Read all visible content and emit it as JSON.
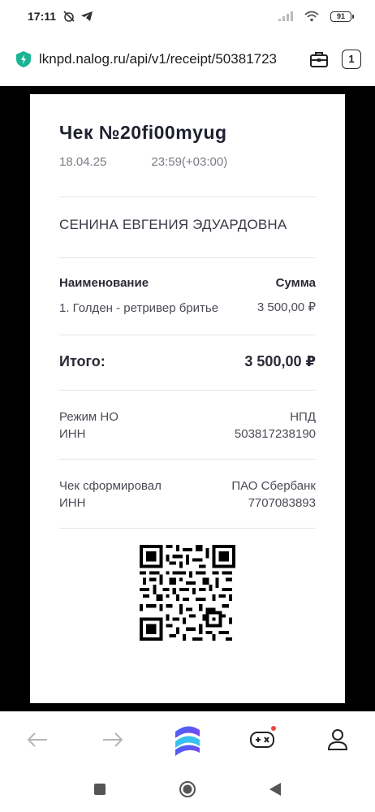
{
  "status_bar": {
    "time": "17:11",
    "battery": "91"
  },
  "browser": {
    "url": "lknpd.nalog.ru/api/v1/receipt/50381723",
    "tab_count": "1"
  },
  "receipt": {
    "title": "Чек №20fi00myug",
    "date": "18.04.25",
    "time": "23:59(+03:00)",
    "customer": "СЕНИНА ЕВГЕНИЯ ЭДУАРДОВНА",
    "col_name": "Наименование",
    "col_sum": "Сумма",
    "items": [
      {
        "name": "1. Голден - ретривер бритье",
        "sum": "3 500,00 ₽"
      }
    ],
    "total_label": "Итого:",
    "total_value": "3 500,00 ₽",
    "tax_mode_label": "Режим НО",
    "tax_mode_value": "НПД",
    "inn_label": "ИНН",
    "inn_value": "503817238190",
    "issuer_label": "Чек сформировал",
    "issuer_value": "ПАО Сбербанк",
    "issuer_inn_label": "ИНН",
    "issuer_inn_value": "7707083893"
  },
  "colors": {
    "accent_green": "#1ab394",
    "page_bg": "#000000",
    "nav_dot": "#e8453c"
  }
}
